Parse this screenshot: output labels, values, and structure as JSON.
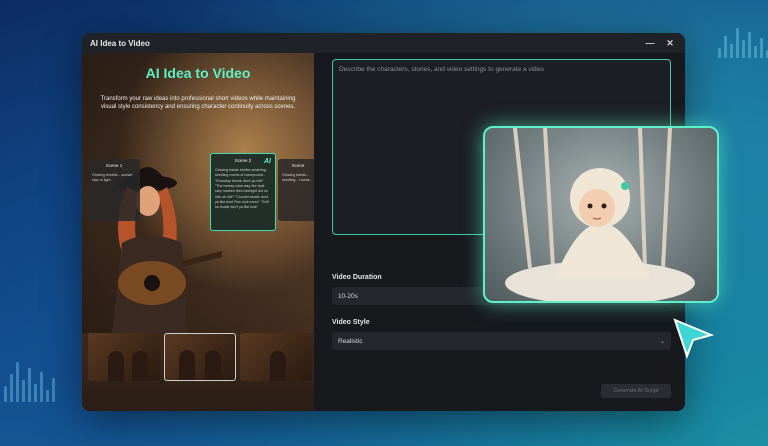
{
  "window": {
    "title": "AI Idea to Video",
    "minimize_icon": "minimize-icon",
    "close_icon": "close-icon"
  },
  "promo": {
    "heading": "AI Idea to Video",
    "description": "Transform your raw ideas into professional short videos while maintaining visual style consistency and ensuring character continuity across scenes."
  },
  "scenes": [
    {
      "title": "Scene 1",
      "text": "Glowing tendrils... sunset rays of light..."
    },
    {
      "title": "Scene 2",
      "text": "Glowing bands birdies zestering seedling rooms of honeycomb... \"Roundup thumb don't ya ride\" \"The beauty calm way like tank step marked fires midnight dot ok ride ok ride\" \"Crochet beads don't ya like bout Fiss rock tuvea\" \"Go'll ka tousle don't ya like kolk\"",
      "badge": "AI"
    },
    {
      "title": "Scene",
      "text": "Glowing bands... seedling... rooms..."
    }
  ],
  "form": {
    "prompt_placeholder": "Describe the characters, stories, and video settings to generate a video",
    "duration_label": "Video Duration",
    "duration_value": "10-20s",
    "style_label": "Video Style",
    "style_value": "Realistic",
    "generate_label": "Generate AI Script"
  },
  "colors": {
    "accent": "#5ef0c8",
    "window_bg": "#17191d",
    "field_bg": "#24272c"
  }
}
